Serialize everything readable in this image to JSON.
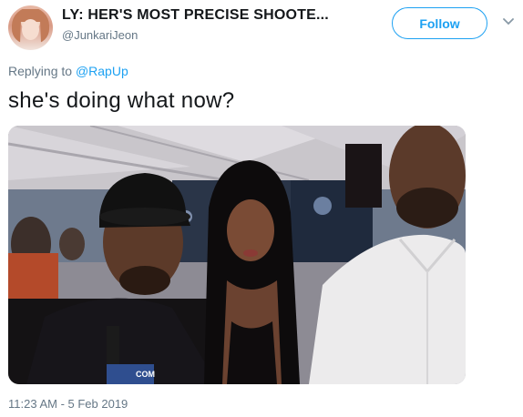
{
  "author": {
    "display_name": "LY: HER'S MOST PRECISE SHOOTE...",
    "handle": "@JunkariJeon"
  },
  "follow_label": "Follow",
  "reply": {
    "prefix": "Replying to ",
    "mention": "@RapUp"
  },
  "tweet_text": "she's doing what now?",
  "media": {
    "mic_label": "COM"
  },
  "timestamp": "11:23 AM - 5 Feb 2019",
  "colors": {
    "accent": "#1da1f2",
    "secondary_text": "#657786",
    "primary_text": "#14171a"
  }
}
